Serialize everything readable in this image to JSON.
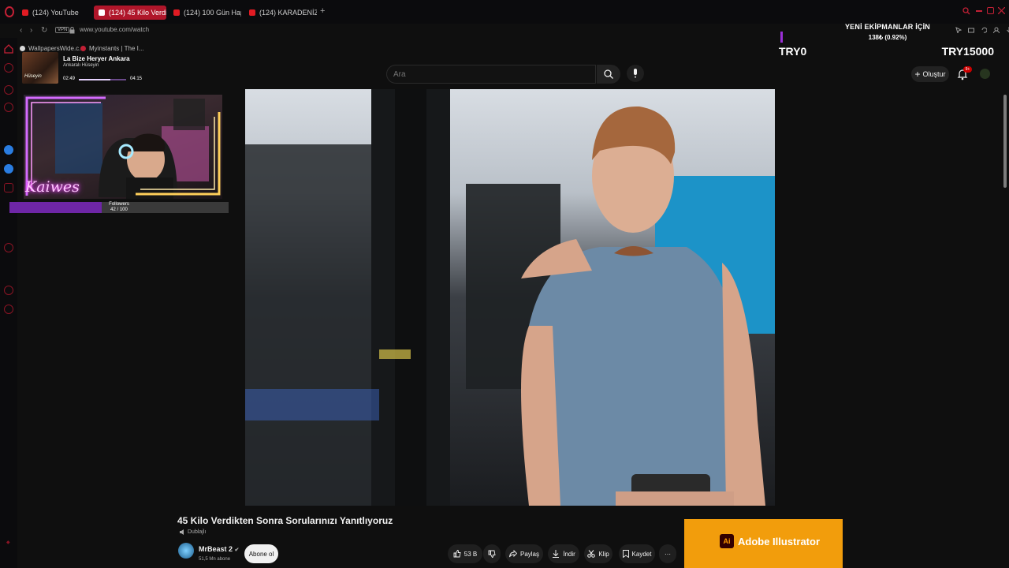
{
  "browser": {
    "tabs": [
      {
        "label": "(124) YouTube"
      },
      {
        "label": "(124) 45 Kilo Verdikt"
      },
      {
        "label": "(124) 100 Gün Hapishane"
      },
      {
        "label": "(124) KARADENİZ BÖLGE"
      }
    ],
    "new_tab": "+",
    "url": "www.youtube.com/watch",
    "vpn_label": "VPN",
    "bookmarks": [
      {
        "label": "WallpapersWide.c..."
      },
      {
        "label": "Myinstants | The I..."
      }
    ]
  },
  "youtube": {
    "search_placeholder": "Ara",
    "create_label": "Oluştur",
    "notification_count": "9+",
    "video_title": "45 Kilo Verdikten Sonra Sorularınızı Yanıtlıyoruz",
    "dub_label": "Dublajlı",
    "channel_name": "MrBeast 2",
    "channel_subs": "51,5 Mn abone",
    "subscribe_label": "Abone ol",
    "likes": "53 B",
    "share_label": "Paylaş",
    "download_label": "İndir",
    "clip_label": "Klip",
    "save_label": "Kaydet",
    "more_label": "···"
  },
  "donation": {
    "title": "YENİ EKİPMANLAR İÇİN",
    "progress_text": "138₺ (0.92%)",
    "min": "TRY0",
    "max": "TRY15000",
    "percent": 0.92
  },
  "music": {
    "song": "La Bize Heryer Ankara",
    "artist": "Ankaralı Hüseyin",
    "album_text": "Hüseyin",
    "current_time": "02:49",
    "total_time": "04:15",
    "progress": 0.66
  },
  "stream": {
    "streamer_name": "Kaiwes",
    "followers_label": "Followers",
    "followers_count": "42 / 100",
    "followers_progress": 0.42
  },
  "ad": {
    "logo": "Ai",
    "text": "Adobe Illustrator",
    "color": "#f29d0c"
  },
  "colors": {
    "accent": "#b0162a",
    "youtube_red": "#e11b23",
    "bg": "#0f0f0f"
  }
}
